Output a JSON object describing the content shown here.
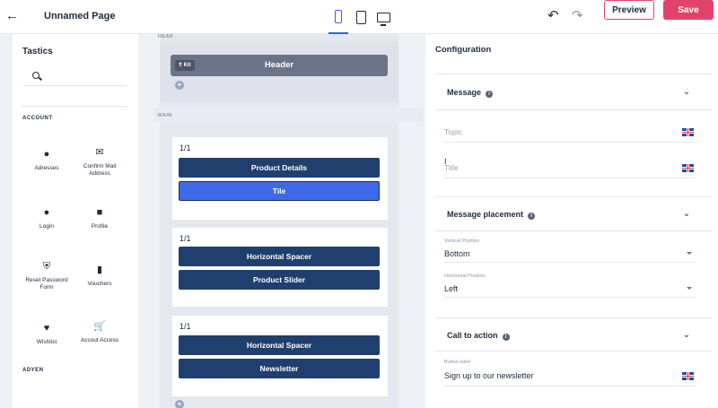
{
  "topbar": {
    "back_icon": "arrow-left-icon",
    "page_title": "Unnamed Page",
    "devices": [
      "mobile",
      "tablet",
      "desktop"
    ],
    "active_device": "mobile",
    "undo_icon": "undo-icon",
    "redo_icon": "redo-icon",
    "preview_label": "Preview",
    "save_label": "Save",
    "accent_color": "#e0446c",
    "active_color": "#3d5ce6"
  },
  "sidebar": {
    "title": "Tastics",
    "search_placeholder": "",
    "sections": [
      {
        "label": "ACCOUNT",
        "items": [
          {
            "label": "Adresses",
            "icon": "map-pin-icon"
          },
          {
            "label": "Confirm Mail Address",
            "icon": "mail-icon"
          },
          {
            "label": "Login",
            "icon": "user-icon"
          },
          {
            "label": "Profile",
            "icon": "profile-card-icon"
          },
          {
            "label": "Reset Password Form",
            "icon": "shield-icon"
          },
          {
            "label": "Vouchers",
            "icon": "bookmark-icon"
          },
          {
            "label": "Wishlist",
            "icon": "heart-icon"
          },
          {
            "label": "Accout Access",
            "icon": "cart-icon"
          }
        ]
      },
      {
        "label": "ADYEN",
        "items": []
      }
    ]
  },
  "canvas": {
    "head_label": "HEAD",
    "main_label": "MAIN",
    "header_block": {
      "badge": "Kit",
      "label": "Header"
    },
    "cards": [
      {
        "ratio": "1/1",
        "blocks": [
          {
            "label": "Product Details",
            "selected": false
          },
          {
            "label": "Tile",
            "selected": true
          }
        ]
      },
      {
        "ratio": "1/1",
        "blocks": [
          {
            "label": "Horizontal Spacer",
            "selected": false
          },
          {
            "label": "Product Slider",
            "selected": false
          }
        ]
      },
      {
        "ratio": "1/1",
        "blocks": [
          {
            "label": "Horizontal Spacer",
            "selected": false
          },
          {
            "label": "Newsletter",
            "selected": false
          }
        ]
      }
    ],
    "block_color": "#1f3f6e",
    "selected_block_color": "#3d6ae6"
  },
  "config": {
    "title": "Configuration",
    "sections": [
      {
        "title": "Message",
        "fields": [
          {
            "placeholder": "Topic",
            "value": "",
            "flag": "uk-flag-icon"
          },
          {
            "placeholder": "Title",
            "value": "",
            "flag": "uk-flag-icon"
          }
        ]
      },
      {
        "title": "Message placement",
        "selects": [
          {
            "label": "Vertical Position",
            "value": "Bottom"
          },
          {
            "label": "Horizontal Position",
            "value": "Left"
          }
        ]
      },
      {
        "title": "Call to action",
        "fields": [
          {
            "label": "Button label",
            "value": "Sign up to our newsletter",
            "flag": "uk-flag-icon"
          }
        ]
      }
    ]
  }
}
